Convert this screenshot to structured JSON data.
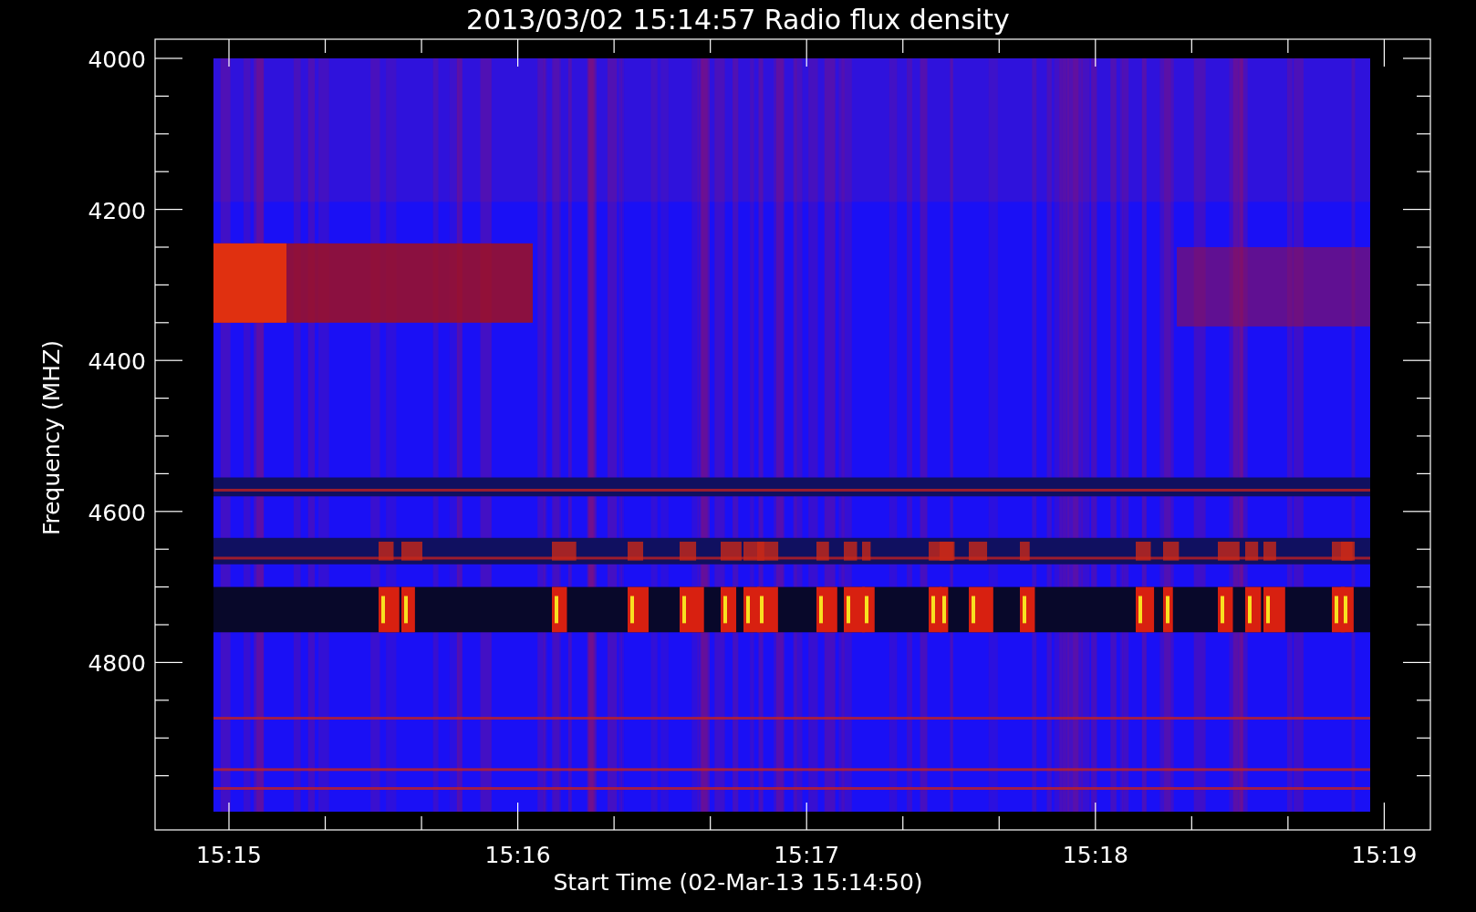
{
  "chart": {
    "title": "2013/03/02 15:14:57 Radio flux density",
    "y_axis": {
      "label": "Frequency (MHZ)",
      "ticks": [
        "4000",
        "4200",
        "4400",
        "4600",
        "4800"
      ]
    },
    "x_axis": {
      "label": "Start Time (02-Mar-13 15:14:50)",
      "ticks": [
        "15:15",
        "15:16",
        "15:17",
        "15:18",
        "15:19"
      ]
    }
  }
}
